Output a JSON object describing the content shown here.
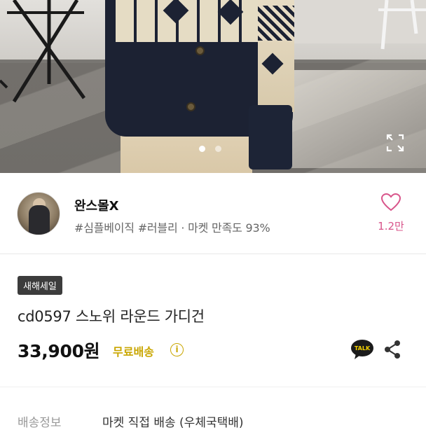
{
  "hero": {
    "image_icon": "product-photo",
    "carousel": {
      "total": 2,
      "active_index": 0
    },
    "expand_icon": "expand-icon"
  },
  "seller": {
    "name": "완스몰X",
    "tags": "#심플베이직 #러블리 · 마켓 만족도 93%",
    "like_count": "1.2만",
    "like_icon": "heart-outline-icon",
    "accent_color": "#d8548a"
  },
  "product": {
    "badge": "새해세일",
    "title": "cd0597 스노위 라운드 가디건",
    "price": "33,900원",
    "shipping": "무료배송",
    "shipping_color": "#c9a600",
    "info_icon_glyph": "i",
    "talk_label": "TALK"
  },
  "delivery": {
    "label": "배송정보",
    "value": "마켓 직접 배송 (우체국택배)"
  }
}
